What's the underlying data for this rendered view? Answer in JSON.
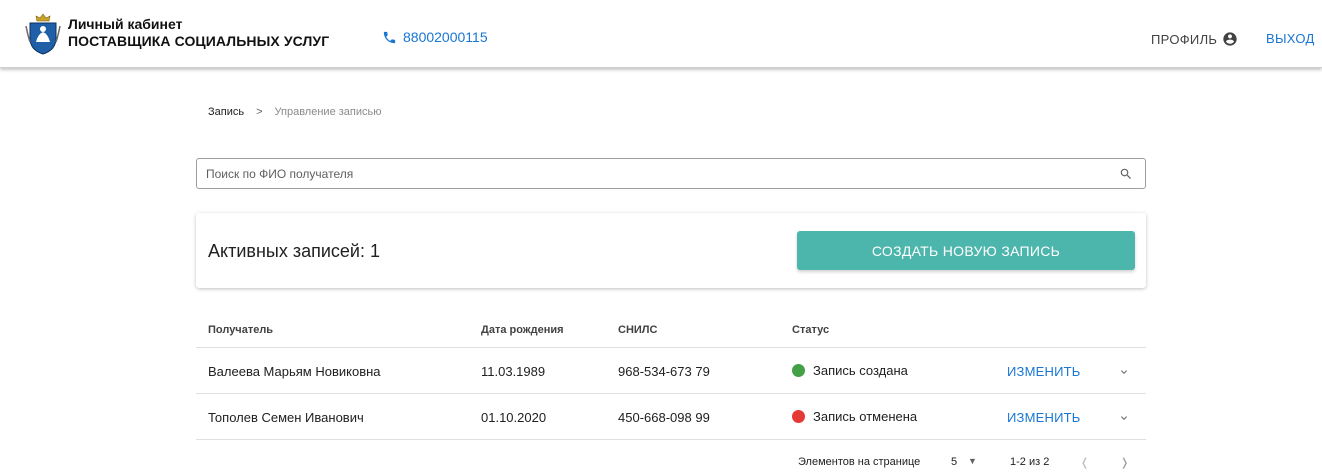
{
  "header": {
    "brand_line1": "Личный кабинет",
    "brand_line2": "ПОСТАВЩИКА СОЦИАЛЬНЫХ УСЛУГ",
    "phone": "88002000115",
    "profile_label": "ПРОФИЛЬ",
    "logout_label": "ВЫХОД",
    "accent_color": "#1976d2"
  },
  "breadcrumb": {
    "items": [
      "Запись",
      "Управление записью"
    ],
    "separator": ">"
  },
  "search": {
    "placeholder": "Поиск по ФИО получателя",
    "value": ""
  },
  "summary": {
    "active_label": "Активных записей: 1",
    "create_button": "СОЗДАТЬ НОВУЮ ЗАПИСЬ",
    "button_color": "#4db6ac"
  },
  "table": {
    "columns": [
      "Получатель",
      "Дата рождения",
      "СНИЛС",
      "Статус"
    ],
    "rows": [
      {
        "name": "Валеева Марьям Новиковна",
        "birth_date": "11.03.1989",
        "snils": "968-534-673 79",
        "status": "Запись создана",
        "status_color": "#43a047",
        "action": "ИЗМЕНИТЬ"
      },
      {
        "name": "Тополев Семен Иванович",
        "birth_date": "01.10.2020",
        "snils": "450-668-098 99",
        "status": "Запись отменена",
        "status_color": "#e53935",
        "action": "ИЗМЕНИТЬ"
      }
    ]
  },
  "pagination": {
    "per_page_label": "Элементов на странице",
    "per_page_value": "5",
    "range": "1-2 из 2"
  }
}
